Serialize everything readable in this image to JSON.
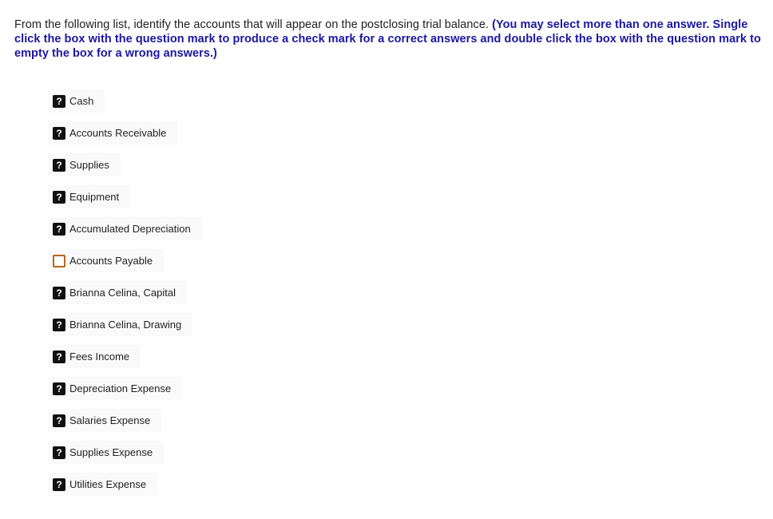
{
  "question": {
    "prompt": "From the following list, identify the accounts that will appear on the postclosing trial balance.",
    "instructions": "(You may select more than one answer. Single click the box with the question mark to produce a check mark for a correct answers and double click the box with the question mark to empty the box for a wrong answers.)"
  },
  "colors": {
    "instruction_text": "#1c17a1",
    "unknown_box": "#111111",
    "empty_box_border": "#b5651d"
  },
  "options": [
    {
      "label": "Cash",
      "state": "unknown",
      "box_glyph": "?"
    },
    {
      "label": "Accounts Receivable",
      "state": "unknown",
      "box_glyph": "?"
    },
    {
      "label": "Supplies",
      "state": "unknown",
      "box_glyph": "?"
    },
    {
      "label": "Equipment",
      "state": "unknown",
      "box_glyph": "?"
    },
    {
      "label": "Accumulated Depreciation",
      "state": "unknown",
      "box_glyph": "?"
    },
    {
      "label": "Accounts Payable",
      "state": "empty",
      "box_glyph": ""
    },
    {
      "label": "Brianna Celina, Capital",
      "state": "unknown",
      "box_glyph": "?"
    },
    {
      "label": "Brianna Celina, Drawing",
      "state": "unknown",
      "box_glyph": "?"
    },
    {
      "label": "Fees Income",
      "state": "unknown",
      "box_glyph": "?"
    },
    {
      "label": "Depreciation Expense",
      "state": "unknown",
      "box_glyph": "?"
    },
    {
      "label": "Salaries Expense",
      "state": "unknown",
      "box_glyph": "?"
    },
    {
      "label": "Supplies Expense",
      "state": "unknown",
      "box_glyph": "?"
    },
    {
      "label": "Utilities Expense",
      "state": "unknown",
      "box_glyph": "?"
    }
  ]
}
